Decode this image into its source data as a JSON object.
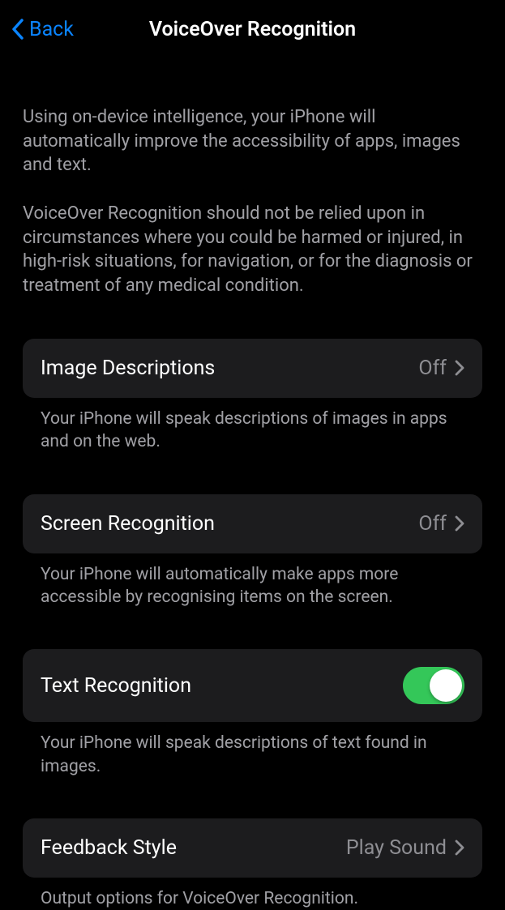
{
  "nav": {
    "back_label": "Back",
    "title": "VoiceOver Recognition"
  },
  "intro": {
    "para1": "Using on-device intelligence, your iPhone will automatically improve the accessibility of apps, images and text.",
    "para2": "VoiceOver Recognition should not be relied upon in circumstances where you could be harmed or injured, in high-risk situations, for navigation, or for the diagnosis or treatment of any medical condition."
  },
  "settings": {
    "image_descriptions": {
      "label": "Image Descriptions",
      "value": "Off",
      "footer": "Your iPhone will speak descriptions of images in apps and on the web."
    },
    "screen_recognition": {
      "label": "Screen Recognition",
      "value": "Off",
      "footer": "Your iPhone will automatically make apps more accessible by recognising items on the screen."
    },
    "text_recognition": {
      "label": "Text Recognition",
      "enabled": true,
      "footer": "Your iPhone will speak descriptions of text found in images."
    },
    "feedback_style": {
      "label": "Feedback Style",
      "value": "Play Sound",
      "footer": "Output options for VoiceOver Recognition."
    }
  }
}
